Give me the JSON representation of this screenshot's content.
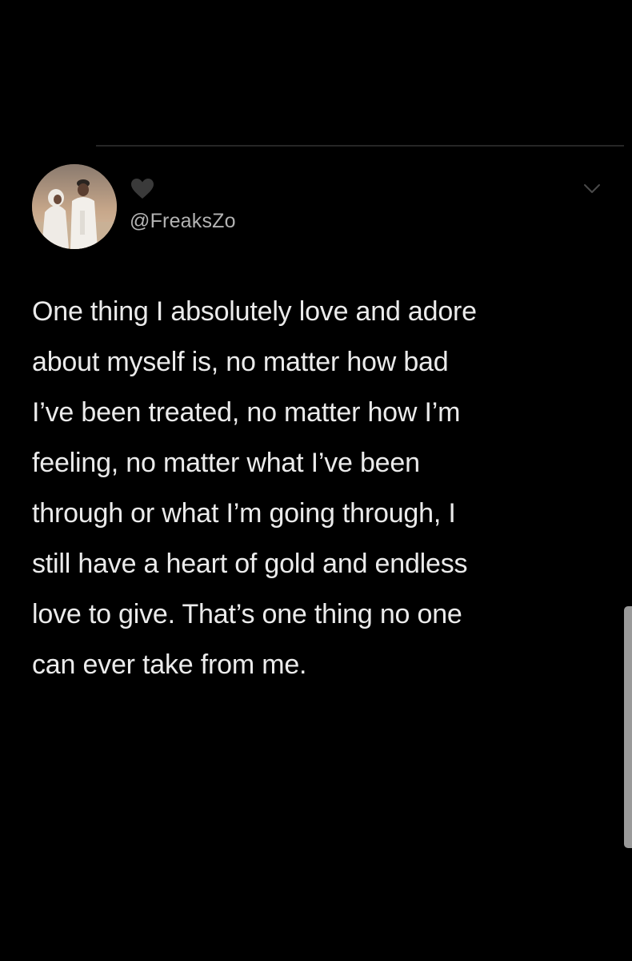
{
  "tweet": {
    "handle": "@FreaksZo",
    "display_name_icon": "black-heart-icon",
    "menu_icon": "chevron-down-icon",
    "text_lines": [
      "One thing I absolutely love and adore",
      "about myself is, no matter how bad",
      "I’ve been treated, no matter how I’m",
      "feeling, no matter what I’ve been",
      "through or what I’m going through, I",
      "still have a heart of gold and endless",
      "love to give. That’s one thing no one",
      "can ever take from me."
    ]
  },
  "colors": {
    "background": "#000000",
    "text": "#ebebeb",
    "handle": "#b3b3b3",
    "divider": "#262626"
  }
}
